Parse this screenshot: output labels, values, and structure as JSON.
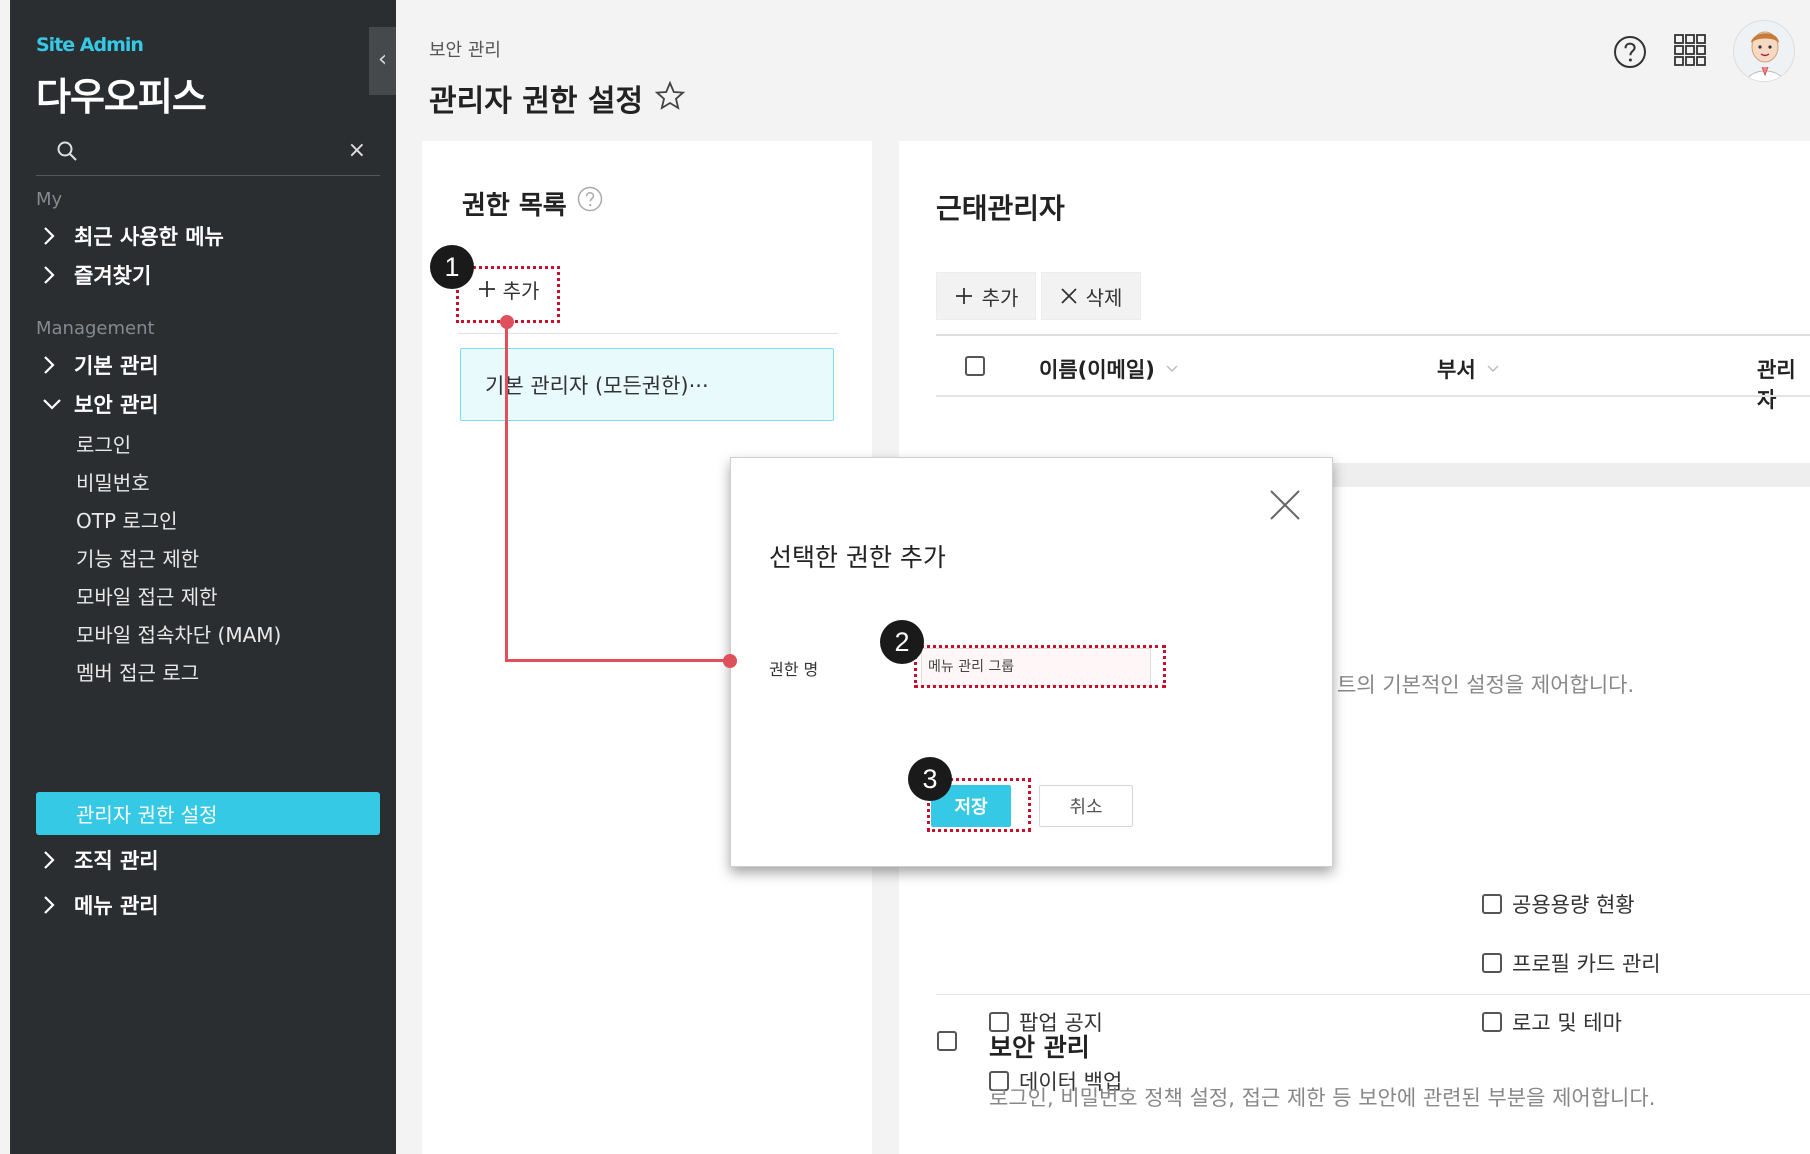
{
  "sidebar": {
    "brand_small": "Site Admin",
    "brand": "다우오피스",
    "collapse_glyph": "‹",
    "clear_glyph": "×",
    "section_my": "My",
    "recent_menu": "최근 사용한 메뉴",
    "favorites": "즐겨찾기",
    "section_management": "Management",
    "basic": "기본 관리",
    "security": "보안 관리",
    "sub": {
      "login": "로그인",
      "password": "비밀번호",
      "otp": "OTP 로그인",
      "feature_restrict": "기능 접근 제한",
      "mobile_restrict": "모바일 접근 제한",
      "mam": "모바일 접속차단 (MAM)",
      "member_log": "멤버 접근 로그",
      "admin_perm": "관리자 권한 설정"
    },
    "org": "조직 관리",
    "menu": "메뉴 관리"
  },
  "header": {
    "breadcrumb": "보안 관리",
    "title": "관리자 권한 설정"
  },
  "left_panel": {
    "title": "권한 목록",
    "add_label": "추가",
    "items": [
      "기본 관리자 (모든권한)···"
    ]
  },
  "right_panel": {
    "title": "근태관리자",
    "add_label": "추가",
    "delete_label": "삭제",
    "columns": [
      "이름(이메일)",
      "부서",
      "관리자"
    ],
    "desc_partial": "트의 기본적인 설정을 제어합니다.",
    "perms_left": [
      "팝업 공지",
      "데이터 백업"
    ],
    "perms_right": [
      "공용용량 현황",
      "프로필 카드 관리",
      "로고 및 테마"
    ],
    "section_title": "보안 관리",
    "section_desc": "로그인, 비밀번호 정책 설정, 접근 제한 등 보안에 관련된 부분을 제어합니다."
  },
  "modal": {
    "title": "선택한 권한 추가",
    "label": "권한 명",
    "input_value": "메뉴 관리 그룹",
    "save": "저장",
    "cancel": "취소"
  },
  "steps": [
    "1",
    "2",
    "3"
  ],
  "colors": {
    "accent": "#35c9e6",
    "sidebar_bg": "#2b2e30",
    "annotation": "#c8102e"
  }
}
